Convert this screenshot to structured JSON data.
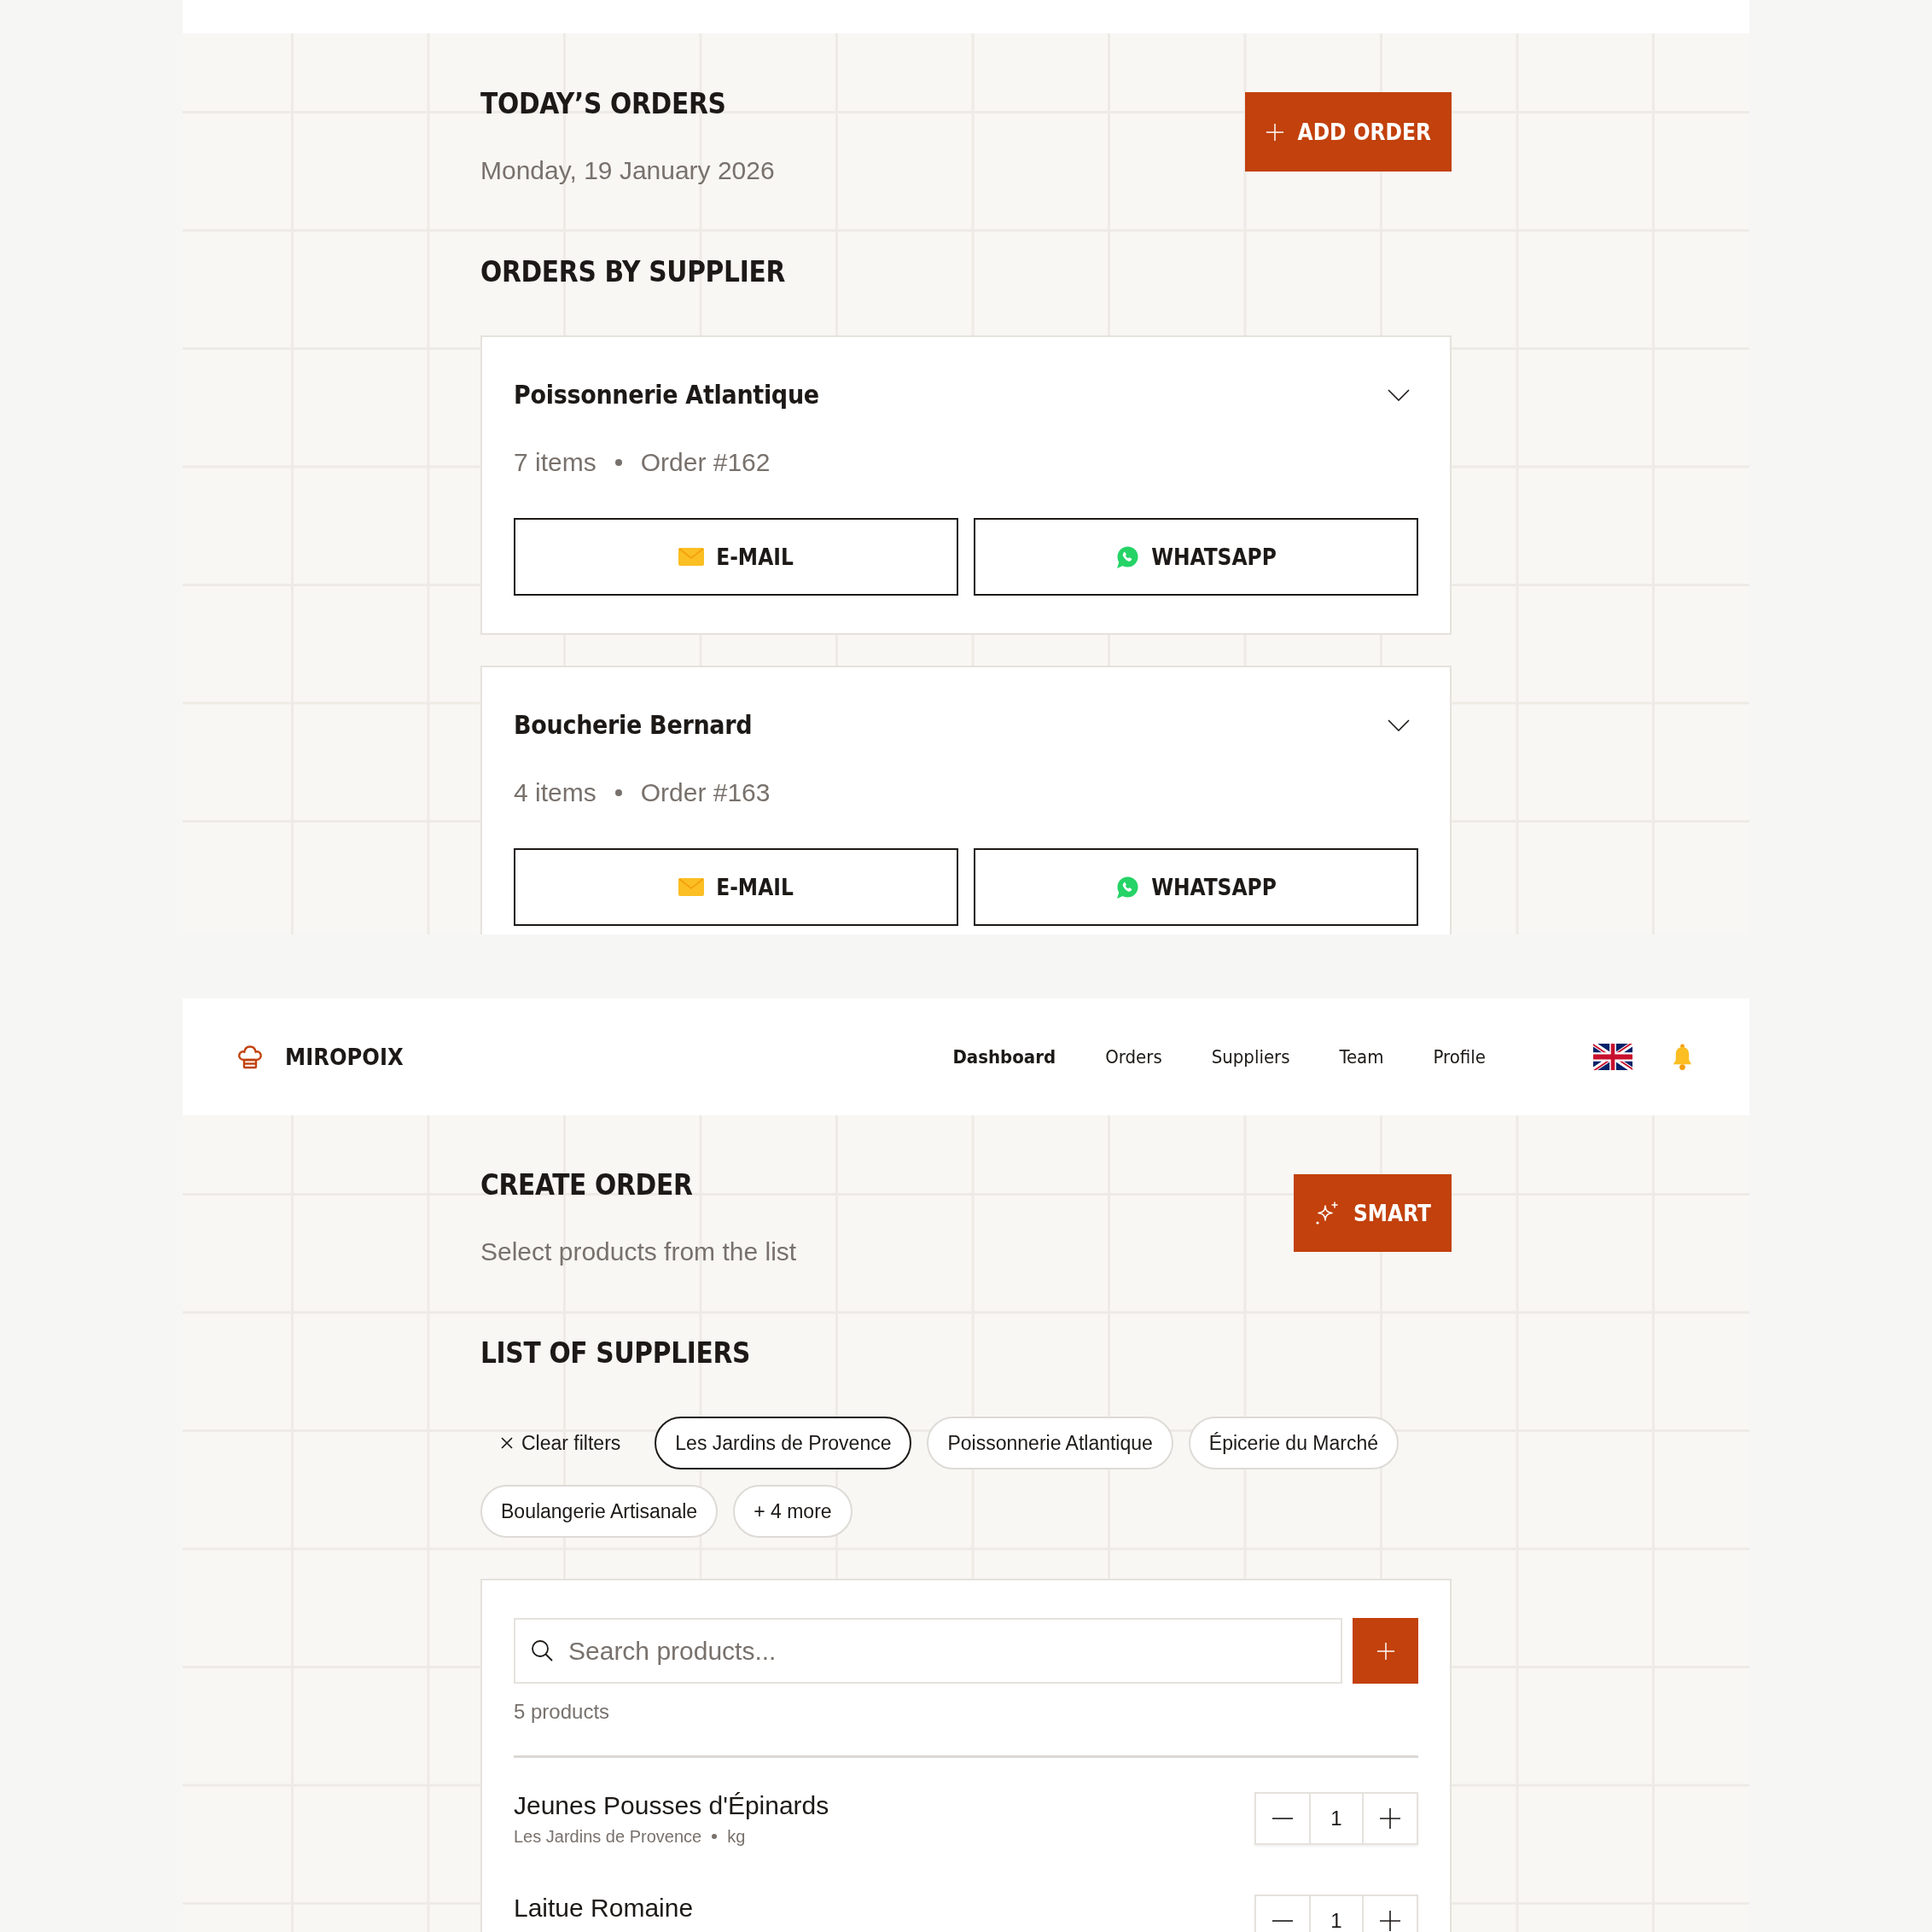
{
  "orders_screen": {
    "title": "TODAY’S ORDERS",
    "date": "Monday, 19 January 2026",
    "add_button": {
      "label": "ADD ORDER"
    },
    "section_title": "ORDERS BY SUPPLIER",
    "suppliers": [
      {
        "name": "Poissonnerie Atlantique",
        "expanded": false,
        "items": "7 items",
        "order": "Order #162",
        "actions": [
          {
            "kind": "email",
            "label": "E-MAIL"
          },
          {
            "kind": "whatsapp",
            "label": "WHATSAPP"
          }
        ]
      },
      {
        "name": "Boucherie Bernard",
        "expanded": false,
        "items": "4 items",
        "order": "Order #163",
        "actions": [
          {
            "kind": "email",
            "label": "E-MAIL"
          },
          {
            "kind": "whatsapp",
            "label": "WHATSAPP"
          }
        ]
      }
    ]
  },
  "create_screen": {
    "nav": {
      "brand": "MIROPOIX",
      "items": [
        {
          "label": "Dashboard",
          "selected": true
        },
        {
          "label": "Orders",
          "selected": false
        },
        {
          "label": "Suppliers",
          "selected": false
        },
        {
          "label": "Team",
          "selected": false
        },
        {
          "label": "Profile",
          "selected": false
        }
      ]
    },
    "title": "CREATE ORDER",
    "subtitle": "Select products from the list",
    "smart_button": {
      "label": "SMART"
    },
    "section_title": "LIST OF SUPPLIERS",
    "clear_filters": {
      "label": "Clear filters"
    },
    "filters": [
      {
        "label": "Les Jardins de Provence",
        "selected": true
      },
      {
        "label": "Poissonnerie Atlantique",
        "selected": false
      },
      {
        "label": "Épicerie du Marché",
        "selected": false
      },
      {
        "label": "Boulangerie Artisanale",
        "selected": false
      }
    ],
    "more_filters": {
      "label": "+ 4 more"
    },
    "search": {
      "placeholder": "Search products..."
    },
    "product_count": "5 products",
    "products": [
      {
        "name": "Jeunes Pousses d'Épinards",
        "supplier": "Les Jardins de Provence",
        "unit": "kg",
        "quantity": "1"
      },
      {
        "name": "Laitue Romaine",
        "quantity": "1"
      }
    ]
  }
}
